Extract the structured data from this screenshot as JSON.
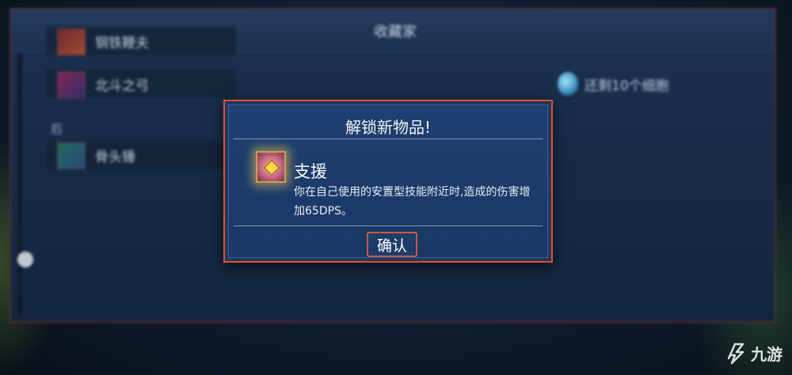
{
  "background_window": {
    "title": "收藏家",
    "list_items": [
      {
        "label": "钢铁鞭夫"
      },
      {
        "label": "北斗之弓"
      },
      {
        "label": "骨头锤"
      }
    ],
    "section_label": "后",
    "remaining_cells_text": "还剩10个细胞"
  },
  "modal": {
    "title": "解锁新物品!",
    "item": {
      "icon": "support-rune-icon",
      "name": "支援",
      "description": "你在自己使用的安置型技能附近时,造成的伤害增加65DPS。"
    },
    "confirm_label": "确认"
  },
  "watermark": {
    "text": "九游"
  },
  "colors": {
    "modal_bg": "#1c3a68",
    "modal_border": "#c85a44",
    "item_glow": "#ffd25a"
  }
}
